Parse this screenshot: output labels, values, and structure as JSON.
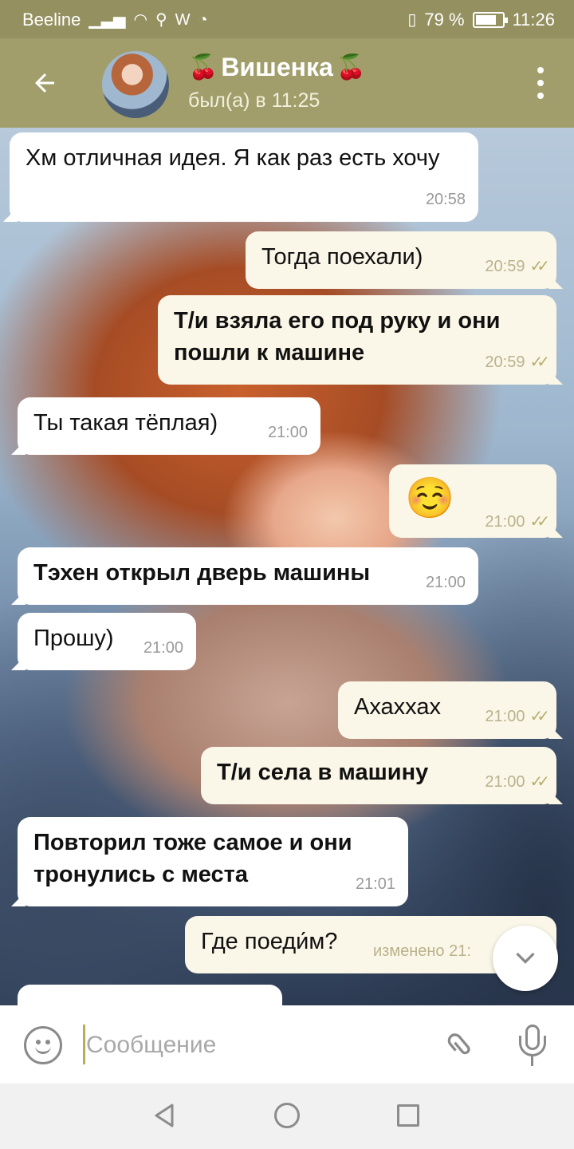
{
  "status_bar": {
    "carrier": "Beeline",
    "battery_text": "79 %",
    "battery_level": 0.79,
    "time": "11:26"
  },
  "header": {
    "name": "Вишенка",
    "cherry": "🍒",
    "last_seen": "был(а) в 11:25"
  },
  "messages": [
    {
      "text": "Хм отличная идея. Я как раз есть хочу",
      "time": "20:58",
      "dir": "in"
    },
    {
      "text": "Тогда поехали)",
      "time": "20:59",
      "dir": "out"
    },
    {
      "text": "Т/и взяла его под руку и они пошли к машине",
      "time": "20:59",
      "dir": "out"
    },
    {
      "text": "Ты такая тёплая)",
      "time": "21:00",
      "dir": "in"
    },
    {
      "text": "☺️",
      "time": "21:00",
      "dir": "out"
    },
    {
      "text": "Тэхен открыл дверь машины",
      "time": "21:00",
      "dir": "in"
    },
    {
      "text": "Прошу)",
      "time": "21:00",
      "dir": "in"
    },
    {
      "text": "Ахаххах",
      "time": "21:00",
      "dir": "out"
    },
    {
      "text": "Т/и села в машину",
      "time": "21:00",
      "dir": "out"
    },
    {
      "text": "Повторил тоже самое и они тронулись с места",
      "time": "21:01",
      "dir": "in"
    },
    {
      "text": "Где поеди́м?",
      "time": "изменено 21:",
      "dir": "out"
    }
  ],
  "input": {
    "placeholder": "Сообщение"
  },
  "icons": {
    "back": "arrow-left",
    "menu": "more-vert",
    "read": "double-check",
    "scroll_down": "chevron-down",
    "emoji": "smiley",
    "attach": "paperclip",
    "mic": "microphone"
  }
}
